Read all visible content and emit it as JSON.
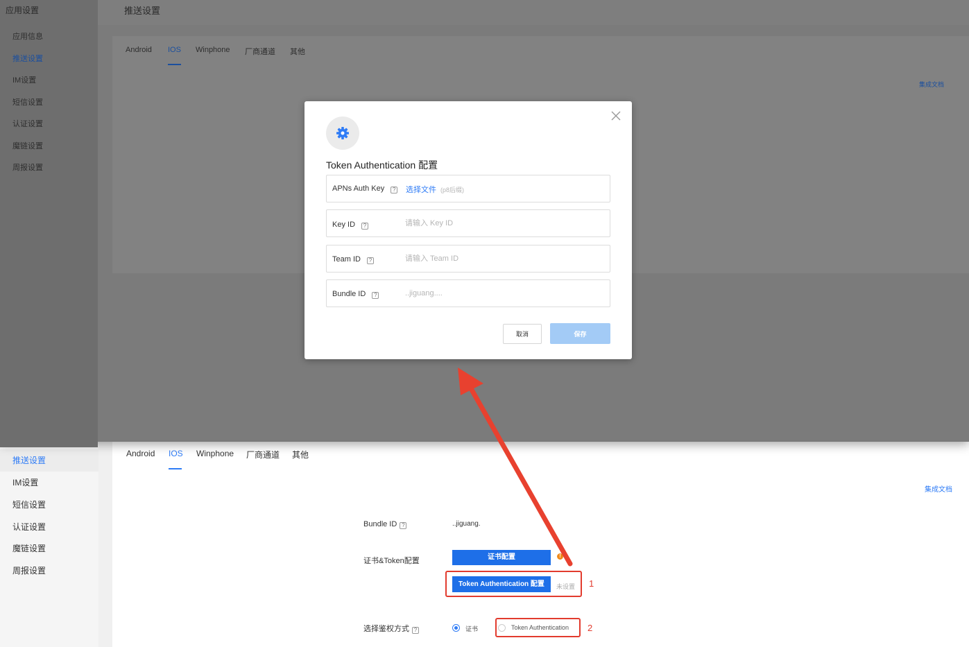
{
  "overlay_page": {
    "sidebar_title": "应用设置",
    "sidebar_items": [
      "应用信息",
      "推送设置",
      "IM设置",
      "短信设置",
      "认证设置",
      "魔链设置",
      "周报设置"
    ],
    "header_title": "推送设置",
    "tabs": [
      "Android",
      "IOS",
      "Winphone",
      "厂商通道",
      "其他"
    ],
    "doc_link": "集成文档"
  },
  "modal": {
    "title": "Token Authentication 配置",
    "icon": "gear-icon",
    "fields": {
      "apns": {
        "label": "APNs Auth Key",
        "link": "选择文件",
        "hint": "(p8后缀)"
      },
      "key_id": {
        "label": "Key ID",
        "placeholder": "请输入 Key ID"
      },
      "team_id": {
        "label": "Team ID",
        "placeholder": "请输入 Team ID"
      },
      "bundle_id": {
        "label": "Bundle ID",
        "value": "..jiguang...."
      }
    },
    "cancel": "取消",
    "save": "保存"
  },
  "main_page": {
    "sidebar_items": [
      "推送设置",
      "IM设置",
      "短信设置",
      "认证设置",
      "魔链设置",
      "周报设置"
    ],
    "active_sidebar": "推送设置",
    "tabs": [
      "Android",
      "IOS",
      "Winphone",
      "厂商通道",
      "其他"
    ],
    "active_tab": "IOS",
    "doc_link": "集成文档",
    "bundle_label": "Bundle ID",
    "bundle_value": "..jiguang.",
    "cert_label": "证书&Token配置",
    "cert_btn": "证书配置",
    "warn_mark": "!",
    "token_btn": "Token Authentication 配置",
    "token_status": "未设置",
    "auth_label": "选择鉴权方式",
    "auth_option_cert": "证书",
    "auth_option_token": "Token Authentication",
    "annotation_1": "1",
    "annotation_2": "2"
  },
  "colors": {
    "accent": "#2f7cf6",
    "primary_button": "#1e6fe8",
    "annotation": "#e23b2e",
    "warning": "#f08a1c",
    "disabled_save": "#a3cbf6"
  }
}
